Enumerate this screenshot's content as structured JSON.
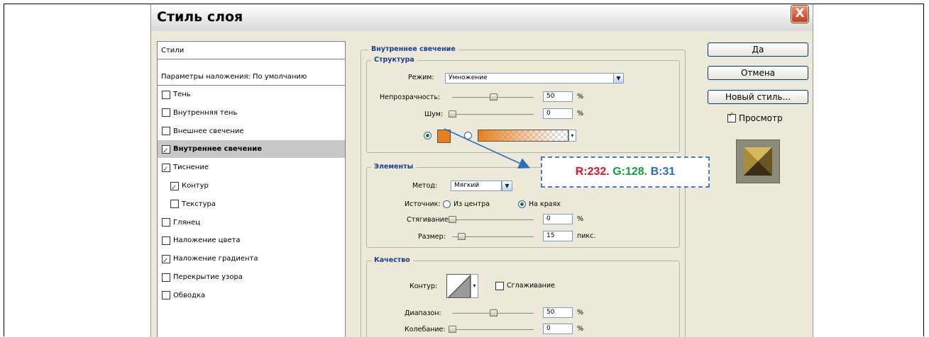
{
  "window": {
    "title": "Стиль слоя",
    "close_label": "X"
  },
  "styles_panel": {
    "header": "Стили",
    "blend_options": "Параметры наложения: По умолчанию",
    "items": [
      {
        "label": "Тень",
        "checked": false
      },
      {
        "label": "Внутренняя тень",
        "checked": false
      },
      {
        "label": "Внешнее свечение",
        "checked": false
      },
      {
        "label": "Внутреннее свечение",
        "checked": true,
        "selected": true
      },
      {
        "label": "Тиснение",
        "checked": true
      },
      {
        "label": "Контур",
        "checked": true,
        "indent": true
      },
      {
        "label": "Текстура",
        "checked": false,
        "indent": true
      },
      {
        "label": "Глянец",
        "checked": false
      },
      {
        "label": "Наложение цвета",
        "checked": false
      },
      {
        "label": "Наложение градиента",
        "checked": true
      },
      {
        "label": "Перекрытие узора",
        "checked": false
      },
      {
        "label": "Обводка",
        "checked": false
      }
    ]
  },
  "inner_glow": {
    "title": "Внутреннее свечение",
    "structure": {
      "title": "Структура",
      "mode_label": "Режим:",
      "mode_value": "Умножение",
      "opacity_label": "Непрозрачность:",
      "opacity_value": "50",
      "opacity_unit": "%",
      "opacity_fraction": 0.5,
      "noise_label": "Шум:",
      "noise_value": "0",
      "noise_unit": "%",
      "noise_fraction": 0.0,
      "color_selected": "solid"
    },
    "elements": {
      "title": "Элементы",
      "method_label": "Метод:",
      "method_value": "Мягкий",
      "source_label": "Источник:",
      "source_center": "Из центра",
      "source_edges": "На краях",
      "source_selected": "edges",
      "choke_label": "Стягивание:",
      "choke_value": "0",
      "choke_unit": "%",
      "choke_fraction": 0.0,
      "size_label": "Размер:",
      "size_value": "15",
      "size_unit": "пикс."
    },
    "quality": {
      "title": "Качество",
      "contour_label": "Контур:",
      "antialias_label": "Сглаживание",
      "antialias_checked": false,
      "range_label": "Диапазон:",
      "range_value": "50",
      "range_unit": "%",
      "range_fraction": 0.5,
      "jitter_label": "Колебание:",
      "jitter_value": "0",
      "jitter_unit": "%",
      "jitter_fraction": 0.0
    }
  },
  "buttons": {
    "ok": "Да",
    "cancel": "Отмена",
    "new_style": "Новый стиль...",
    "preview_label": "Просмотр",
    "preview_checked": true
  },
  "callout": {
    "r": "R:232.",
    "g": "G:128.",
    "b": "B:31"
  },
  "colors": {
    "glow_color": "#e8801f",
    "accent_blue": "#1c3a9c",
    "callout_border": "#4d7ac4"
  }
}
